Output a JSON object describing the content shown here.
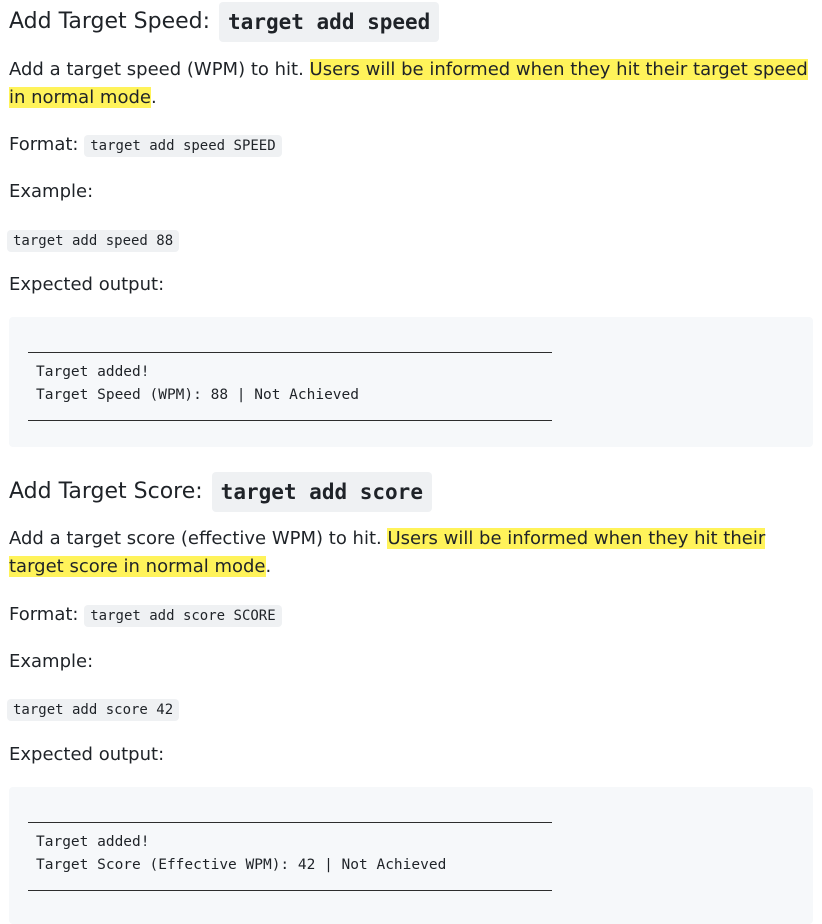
{
  "sections": [
    {
      "heading_text": "Add Target Speed:",
      "heading_code": "target add speed",
      "desc_plain": "Add a target speed (WPM) to hit. ",
      "desc_highlight": "Users will be informed when they hit their target speed in normal mode",
      "desc_end": ".",
      "format_label": "Format:",
      "format_code": "target add speed SPEED",
      "example_label": "Example:",
      "example_code": "target add speed 88",
      "output_label": "Expected output:",
      "output_lines": [
        "Target added!",
        "Target Speed (WPM): 88 | Not Achieved"
      ]
    },
    {
      "heading_text": "Add Target Score:",
      "heading_code": "target add score",
      "desc_plain": "Add a target score (effective WPM) to hit. ",
      "desc_highlight": "Users will be informed when they hit their target score in normal mode",
      "desc_end": ".",
      "format_label": "Format:",
      "format_code": "target add score SCORE",
      "example_label": "Example:",
      "example_code": "target add score 42",
      "output_label": "Expected output:",
      "output_lines": [
        "Target added!",
        "Target Score (Effective WPM): 42 | Not Achieved"
      ]
    }
  ]
}
